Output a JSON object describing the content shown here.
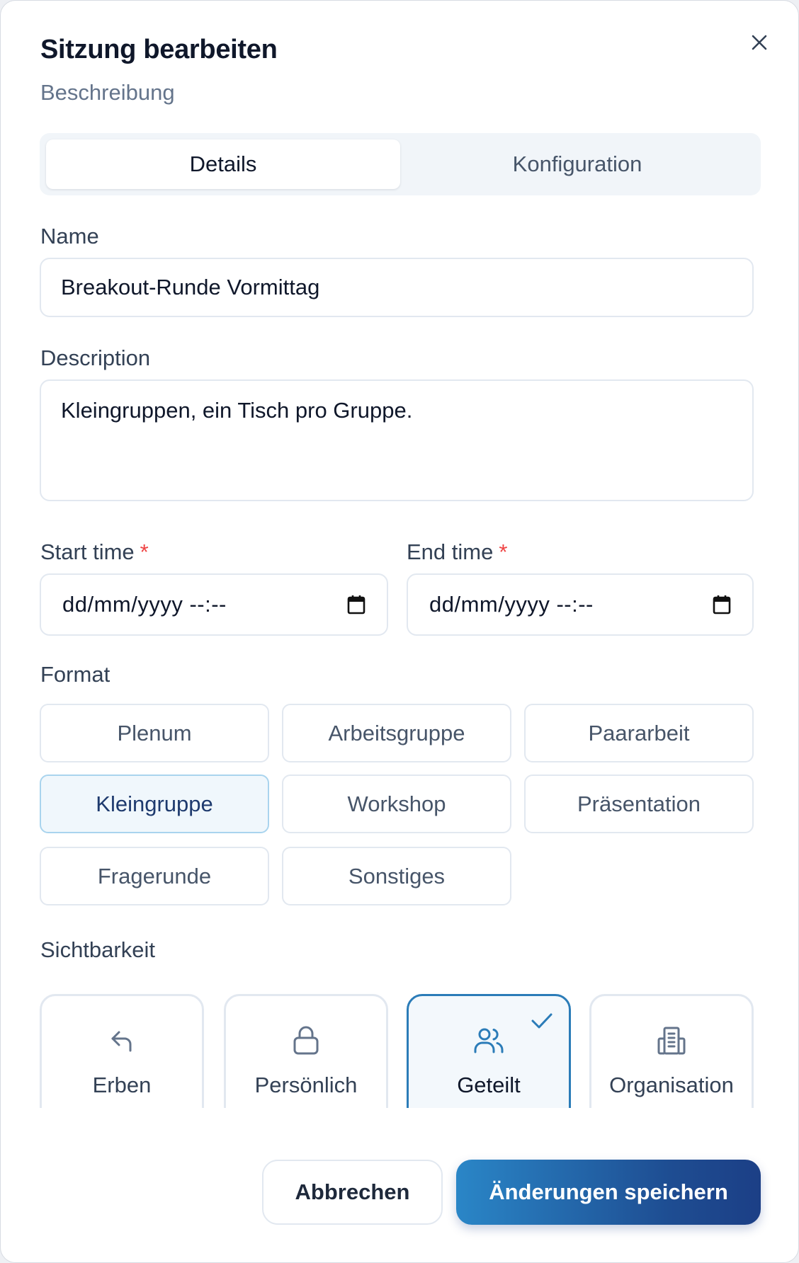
{
  "dialog": {
    "title": "Sitzung bearbeiten",
    "subtitle": "Beschreibung"
  },
  "tabs": [
    {
      "label": "Details",
      "active": true
    },
    {
      "label": "Konfiguration",
      "active": false
    }
  ],
  "form": {
    "name_label": "Name",
    "name_value": "Breakout-Runde Vormittag",
    "description_label": "Description",
    "description_value": "Kleingruppen, ein Tisch pro Gruppe.",
    "start_label": "Start time",
    "start_value": "dd/mm/yyyy --:--",
    "end_label": "End time",
    "end_value": "dd/mm/yyyy --:--",
    "required_mark": "*"
  },
  "format": {
    "label": "Format",
    "selected": "Kleingruppe",
    "options": [
      "Plenum",
      "Arbeitsgruppe",
      "Paararbeit",
      "Kleingruppe",
      "Workshop",
      "Präsentation",
      "Fragerunde",
      "Sonstiges"
    ]
  },
  "visibility": {
    "label": "Sichtbarkeit",
    "selected": "Geteilt",
    "options": [
      {
        "label": "Erben",
        "icon": "reply-arrow-icon"
      },
      {
        "label": "Persönlich",
        "icon": "lock-icon"
      },
      {
        "label": "Geteilt",
        "icon": "users-icon"
      },
      {
        "label": "Organisation",
        "icon": "building-icon"
      }
    ]
  },
  "actions": {
    "cancel_label": "Abbrechen",
    "save_label": "Änderungen speichern"
  },
  "colors": {
    "accent": "#2b7cb8",
    "required": "#ef4444",
    "save_gradient_start": "#2a86c7",
    "save_gradient_end": "#1c3f86"
  }
}
